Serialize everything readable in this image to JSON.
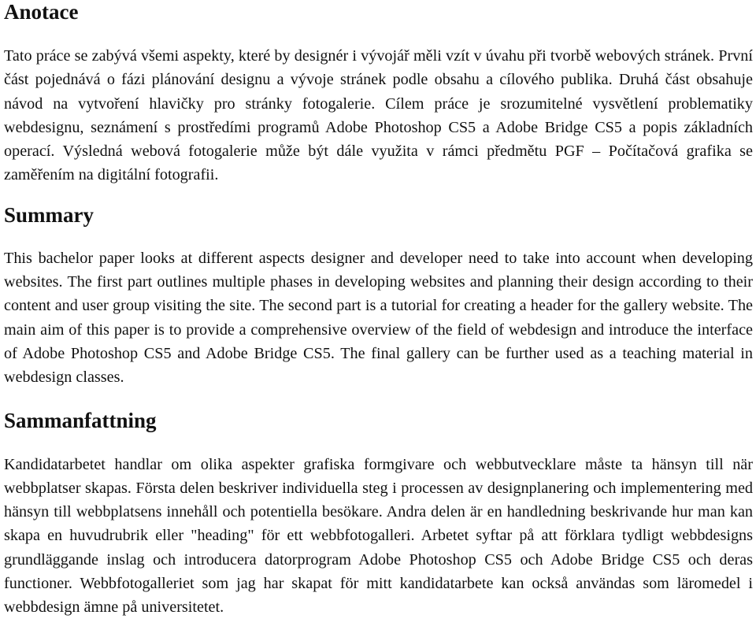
{
  "sections": [
    {
      "heading": "Anotace",
      "text": "Tato práce se zabývá všemi aspekty, které by designér i vývojář měli vzít v úvahu při tvorbě webových stránek. První část pojednává o fázi plánování designu a vývoje stránek podle obsahu a cílového publika. Druhá část obsahuje návod na vytvoření hlavičky pro stránky fotogalerie. Cílem práce je srozumitelné vysvětlení problematiky webdesignu, seznámení s prostředími programů Adobe Photoshop CS5 a Adobe Bridge CS5 a popis základních operací. Výsledná webová fotogalerie může být dále využita v rámci předmětu PGF – Počítačová grafika se zaměřením na digitální fotografii."
    },
    {
      "heading": "Summary",
      "text": "This bachelor paper looks at different aspects designer and developer need to take into account when developing websites. The first part outlines multiple phases in developing websites and planning their design according to their content and user group visiting the site. The second part is a tutorial for creating a header for the gallery website. The main aim of this paper is to provide a comprehensive overview of the field of webdesign and introduce the interface of Adobe Photoshop CS5 and Adobe Bridge CS5. The final gallery can be further used as a teaching material in webdesign classes."
    },
    {
      "heading": "Sammanfattning",
      "text": "Kandidatarbetet handlar om olika aspekter grafiska formgivare och webbutvecklare måste ta hänsyn till när webbplatser skapas. Första delen beskriver individuella steg i processen av designplanering och implementering med hänsyn till webbplatsens innehåll och potentiella besökare. Andra delen är en handledning beskrivande hur man kan skapa en huvudrubrik eller \"heading\" för ett webbfotogalleri. Arbetet syftar på att förklara tydligt webbdesigns grundläggande inslag och introducera datorprogram Adobe Photoshop CS5 och Adobe Bridge CS5 och deras functioner. Webbfotogalleriet som jag har skapat för mitt kandidatarbete kan också användas som läromedel i webbdesign ämne på universitetet."
    }
  ]
}
